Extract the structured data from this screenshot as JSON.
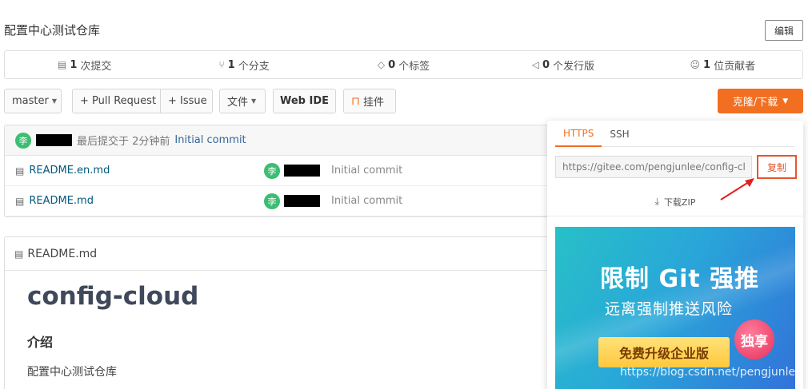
{
  "repo": {
    "title": "配置中心测试仓库",
    "edit_label": "编辑"
  },
  "stats": [
    {
      "icon": "commit-icon",
      "count": "1",
      "label": "次提交"
    },
    {
      "icon": "branch-icon",
      "count": "1",
      "label": "个分支"
    },
    {
      "icon": "tag-icon",
      "count": "0",
      "label": "个标签"
    },
    {
      "icon": "release-icon",
      "count": "0",
      "label": "个发行版"
    },
    {
      "icon": "contributors-icon",
      "count": "1",
      "label": "位贡献者"
    }
  ],
  "toolbar": {
    "branch": "master",
    "pull_request": "+ Pull Request",
    "issue": "+ Issue",
    "file": "文件",
    "webide": "Web IDE",
    "widget": "挂件",
    "clone": "克隆/下载"
  },
  "commit_bar": {
    "avatar": "李",
    "text": "最后提交于 2分钟前",
    "message": "Initial commit"
  },
  "files": [
    {
      "name": "README.en.md",
      "avatar": "李",
      "message": "Initial commit"
    },
    {
      "name": "README.md",
      "avatar": "李",
      "message": "Initial commit"
    }
  ],
  "readme": {
    "file": "README.md",
    "h1": "config-cloud",
    "h2": "介绍",
    "p": "配置中心测试仓库"
  },
  "clone_popup": {
    "tabs": [
      "HTTPS",
      "SSH"
    ],
    "url": "https://gitee.com/pengjunlee/config-cloud.git",
    "copy": "复制",
    "zip": "下载ZIP",
    "banner_title": "限制 Git 强推",
    "banner_sub": "远离强制推送风险",
    "banner_badge": "独享",
    "banner_cta": "免费升级企业版"
  },
  "watermark": "https://blog.csdn.net/pengjunlee",
  "colors": {
    "accent": "#f26f21",
    "avatar": "#3dbd72",
    "link": "#005980"
  }
}
